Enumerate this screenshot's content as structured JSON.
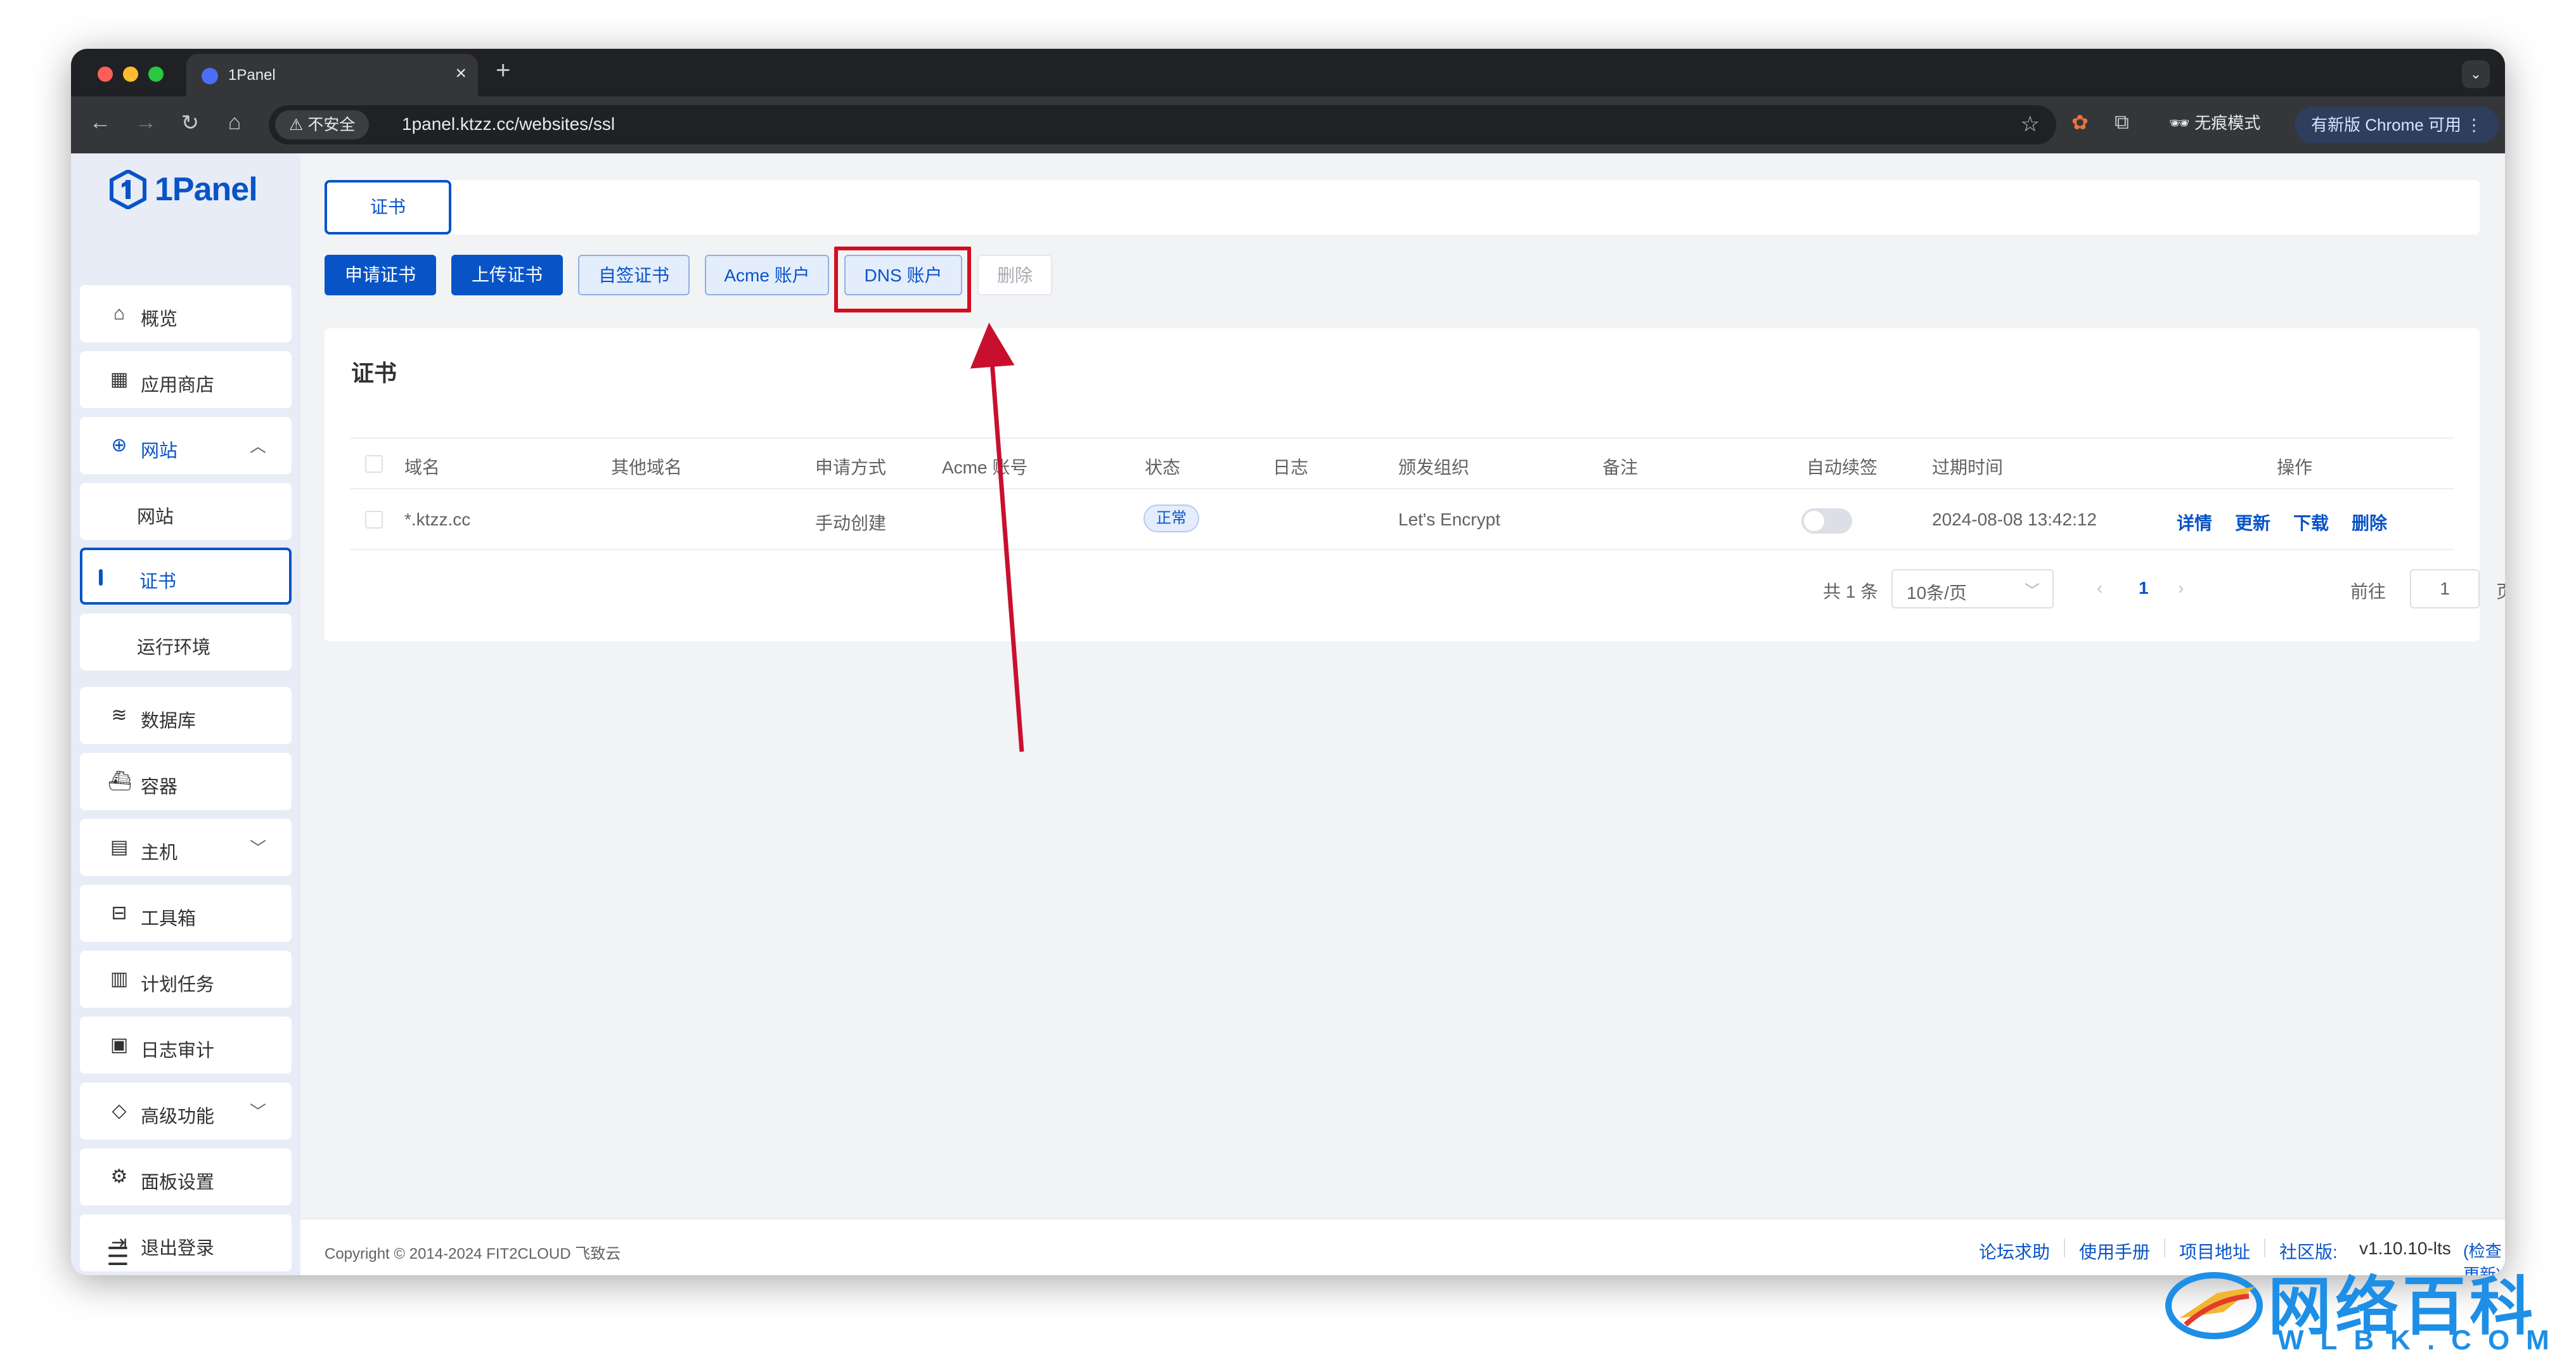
{
  "browser": {
    "tab_title": "1Panel",
    "insecure_label": "不安全",
    "url": "1panel.ktzz.cc/websites/ssl",
    "incognito_label": "无痕模式",
    "update_label": "有新版 Chrome 可用"
  },
  "sidebar": {
    "logo": "1Panel",
    "items": [
      {
        "label": "概览"
      },
      {
        "label": "应用商店"
      },
      {
        "label": "网站"
      },
      {
        "label": "网站"
      },
      {
        "label": "证书"
      },
      {
        "label": "运行环境"
      },
      {
        "label": "数据库"
      },
      {
        "label": "容器"
      },
      {
        "label": "主机"
      },
      {
        "label": "工具箱"
      },
      {
        "label": "计划任务"
      },
      {
        "label": "日志审计"
      },
      {
        "label": "高级功能"
      },
      {
        "label": "面板设置"
      },
      {
        "label": "退出登录"
      }
    ]
  },
  "main": {
    "tab_label": "证书",
    "buttons": {
      "apply": "申请证书",
      "upload": "上传证书",
      "self_signed": "自签证书",
      "acme": "Acme 账户",
      "dns": "DNS 账户",
      "delete": "删除"
    },
    "card_title": "证书",
    "table": {
      "headers": [
        "域名",
        "其他域名",
        "申请方式",
        "Acme 账号",
        "状态",
        "日志",
        "颁发组织",
        "备注",
        "自动续签",
        "过期时间",
        "操作"
      ],
      "rows": [
        {
          "domain": "*.ktzz.cc",
          "other_domains": "",
          "apply_method": "手动创建",
          "acme_account": "",
          "status": "正常",
          "issuer": "Let's Encrypt",
          "note": "",
          "auto_renew": false,
          "expire_time": "2024-08-08 13:42:12",
          "actions": [
            "详情",
            "更新",
            "下载",
            "删除"
          ]
        }
      ]
    },
    "pagination": {
      "total": "共 1 条",
      "page_size": "10条/页",
      "current_page": "1",
      "goto_label": "前往",
      "goto_value": "1",
      "page_unit": "页"
    }
  },
  "footer": {
    "copyright": "Copyright © 2014-2024 FIT2CLOUD 飞致云",
    "links": [
      "论坛求助",
      "使用手册",
      "项目地址"
    ],
    "edition_label": "社区版:",
    "version": "v1.10.10-lts",
    "check_update": "(检查更新)"
  },
  "watermark": {
    "title": "网络百科",
    "subtitle": "WLBK.COM"
  },
  "colors": {
    "primary": "#0854c7",
    "highlight": "#d40d20",
    "sidebar_bg": "#e8ecf6"
  }
}
